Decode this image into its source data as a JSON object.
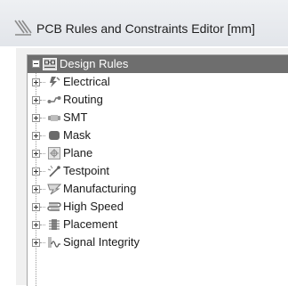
{
  "window": {
    "title": "PCB Rules and Constraints Editor [mm]",
    "title_icon": "rules-editor-icon"
  },
  "tree": {
    "root": {
      "label": "Design Rules",
      "icon": "design-rules-icon",
      "expanded": true,
      "selected": true
    },
    "items": [
      {
        "label": "Electrical",
        "icon": "electrical-icon"
      },
      {
        "label": "Routing",
        "icon": "routing-icon"
      },
      {
        "label": "SMT",
        "icon": "smt-icon"
      },
      {
        "label": "Mask",
        "icon": "mask-icon"
      },
      {
        "label": "Plane",
        "icon": "plane-icon"
      },
      {
        "label": "Testpoint",
        "icon": "testpoint-icon"
      },
      {
        "label": "Manufacturing",
        "icon": "manufacturing-icon"
      },
      {
        "label": "High Speed",
        "icon": "high-speed-icon"
      },
      {
        "label": "Placement",
        "icon": "placement-icon"
      },
      {
        "label": "Signal Integrity",
        "icon": "signal-integrity-icon"
      }
    ]
  },
  "colors": {
    "selection": "#6e6e6e",
    "selection_text": "#ffffff"
  }
}
